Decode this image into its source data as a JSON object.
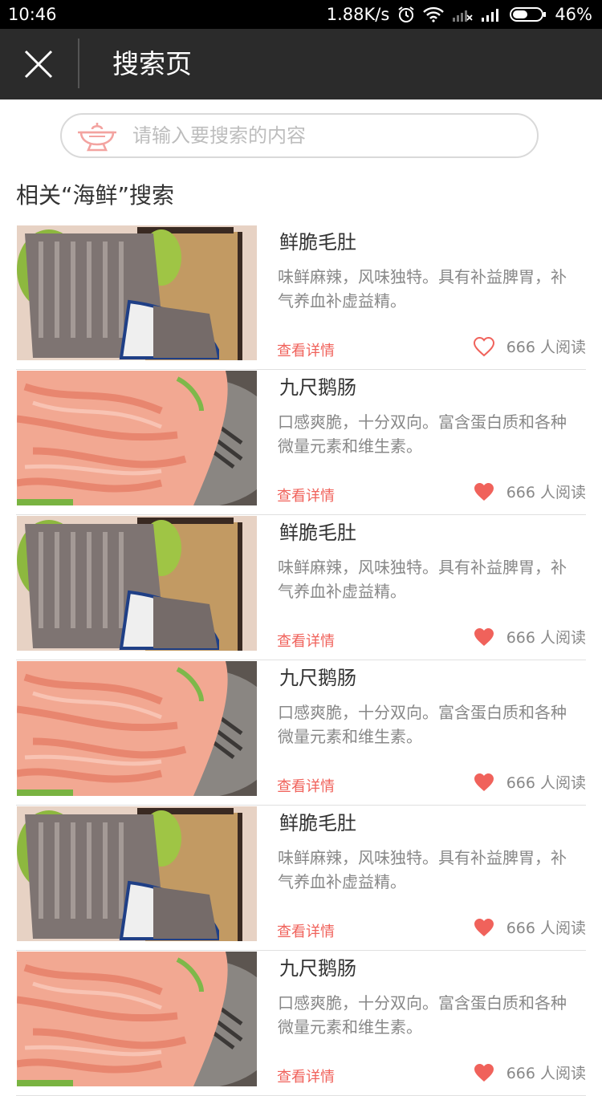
{
  "status_bar": {
    "time": "10:46",
    "speed": "1.88K/s",
    "battery": "46%",
    "icons": [
      "alarm-icon",
      "wifi-icon",
      "signal-off-icon",
      "signal-icon",
      "battery-icon"
    ]
  },
  "header": {
    "title": "搜索页",
    "close_icon": "close-icon"
  },
  "search": {
    "placeholder": "请输入要搜索的内容",
    "icon": "hotpot-bowl-icon"
  },
  "section_title": "相关“海鲜”搜索",
  "colors": {
    "accent": "#f0625b",
    "header_bg": "#2b2b2b",
    "text_muted": "#888888"
  },
  "items": [
    {
      "title": "鲜脆毛肚",
      "desc": "味鲜麻辣，风味独特。具有补益脾胃，补气养血补虚益精。",
      "link": "查看详情",
      "reads": "666 人阅读",
      "liked": false,
      "image": "tripe"
    },
    {
      "title": "九尺鹅肠",
      "desc": "口感爽脆，十分双向。富含蛋白质和各种微量元素和维生素。",
      "link": "查看详情",
      "reads": "666 人阅读",
      "liked": true,
      "image": "goose-intestine"
    },
    {
      "title": "鲜脆毛肚",
      "desc": "味鲜麻辣，风味独特。具有补益脾胃，补气养血补虚益精。",
      "link": "查看详情",
      "reads": "666 人阅读",
      "liked": true,
      "image": "tripe"
    },
    {
      "title": "九尺鹅肠",
      "desc": "口感爽脆，十分双向。富含蛋白质和各种微量元素和维生素。",
      "link": "查看详情",
      "reads": "666 人阅读",
      "liked": true,
      "image": "goose-intestine"
    },
    {
      "title": "鲜脆毛肚",
      "desc": "味鲜麻辣，风味独特。具有补益脾胃，补气养血补虚益精。",
      "link": "查看详情",
      "reads": "666 人阅读",
      "liked": true,
      "image": "tripe"
    },
    {
      "title": "九尺鹅肠",
      "desc": "口感爽脆，十分双向。富含蛋白质和各种微量元素和维生素。",
      "link": "查看详情",
      "reads": "666 人阅读",
      "liked": true,
      "image": "goose-intestine"
    }
  ]
}
